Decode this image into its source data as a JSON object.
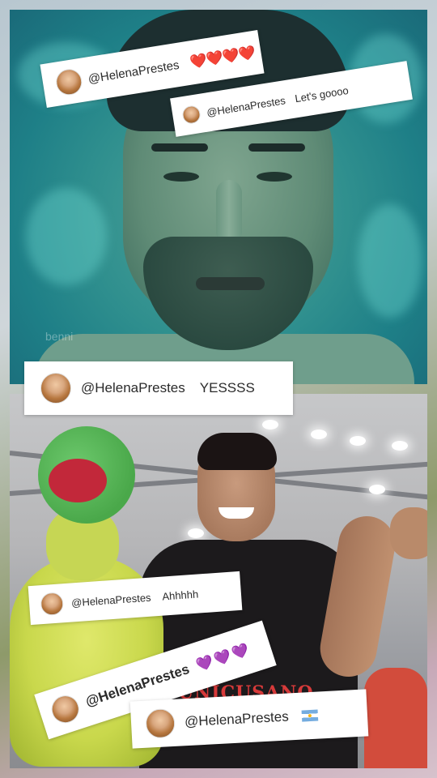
{
  "comments": [
    {
      "handle": "@HelenaPrestes",
      "text": "❤️❤️❤️❤️"
    },
    {
      "handle": "@HelenaPrestes",
      "text": "Let's goooo"
    },
    {
      "handle": "@HelenaPrestes",
      "text": "YESSSS"
    },
    {
      "handle": "@HelenaPrestes",
      "text": "Ahhhhh"
    },
    {
      "handle": "@HelenaPrestes",
      "text": "💜💜💜"
    },
    {
      "handle": "@HelenaPrestes",
      "flag": "argentina-flag-icon"
    }
  ],
  "photos": {
    "top": {
      "watermark": "benni"
    },
    "bottom": {
      "jersey_text": "UNICUSANO"
    }
  },
  "colors": {
    "heart": "#d8193c",
    "pink_heart": "#d94fb5",
    "top_photo_tint": "#2f8f8e"
  }
}
